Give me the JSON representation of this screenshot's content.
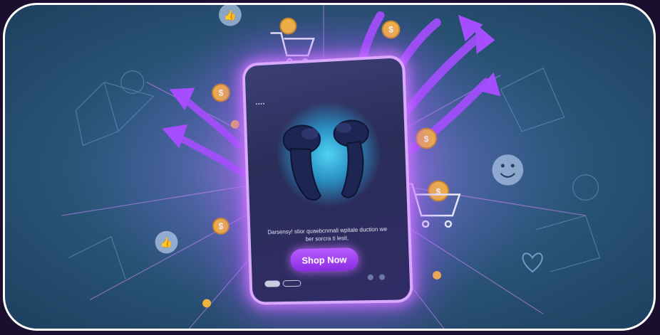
{
  "ad": {
    "body_text": "Darsensy! stior quaebcnmali wpitale duction we ber sorcra ti lesit.",
    "button_label": "Shop Now",
    "status_text": "••••"
  },
  "colors": {
    "accent": "#a64dff",
    "frame": "#ffffff",
    "background": "#2f5a85",
    "coin": "#f2b53a"
  },
  "icons": [
    "thumbs-up-icon",
    "shopping-cart-icon",
    "coin-icon",
    "smiley-icon",
    "arrow-icon",
    "heart-icon",
    "network-icon"
  ]
}
